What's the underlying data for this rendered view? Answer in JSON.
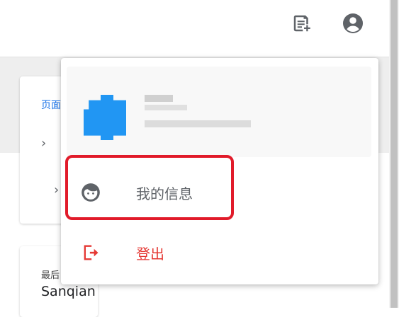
{
  "topbar": {
    "icons": [
      "note-add-icon",
      "account-circle-icon"
    ]
  },
  "background_cards": {
    "card1_link": "页面",
    "card2_label": "最后",
    "card2_value": "Sanqian"
  },
  "dropdown": {
    "menu": [
      {
        "label": "我的信息",
        "icon": "face-icon",
        "color": "#5f6368"
      },
      {
        "label": "登出",
        "icon": "logout-icon",
        "color": "#e53935"
      }
    ]
  },
  "colors": {
    "accent": "#1a73e8",
    "avatar": "#2196f3",
    "logout": "#e53935",
    "highlight": "#e11b2a"
  }
}
